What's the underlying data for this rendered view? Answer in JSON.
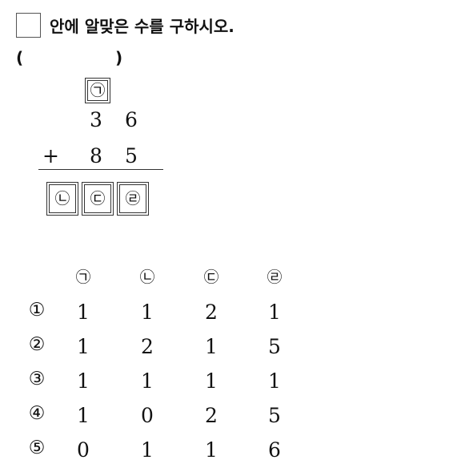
{
  "question": {
    "text": "안에 알맞은 수를 구하시오."
  },
  "answer_paren": {
    "open": "(",
    "close": ")"
  },
  "problem": {
    "box_top": "㉠",
    "row1": [
      "3",
      "6"
    ],
    "operator": "+",
    "row2": [
      "8",
      "5"
    ],
    "boxes_bottom": [
      "㉡",
      "㉢",
      "㉣"
    ]
  },
  "choices": {
    "headers": [
      "㉠",
      "㉡",
      "㉢",
      "㉣"
    ],
    "rows": [
      {
        "label": "①",
        "values": [
          "1",
          "1",
          "2",
          "1"
        ]
      },
      {
        "label": "②",
        "values": [
          "1",
          "2",
          "1",
          "5"
        ]
      },
      {
        "label": "③",
        "values": [
          "1",
          "1",
          "1",
          "1"
        ]
      },
      {
        "label": "④",
        "values": [
          "1",
          "0",
          "2",
          "5"
        ]
      },
      {
        "label": "⑤",
        "values": [
          "0",
          "1",
          "1",
          "6"
        ]
      }
    ]
  }
}
